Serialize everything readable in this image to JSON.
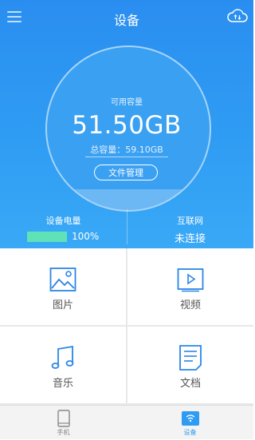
{
  "header": {
    "title": "设备",
    "menu_icon": "menu-icon",
    "cloud_icon": "cloud-sync-icon"
  },
  "storage": {
    "available_label": "可用容量",
    "available_value": "51.50GB",
    "total_text": "总容量：59.10GB",
    "file_button_label": "文件管理"
  },
  "status": {
    "battery_label": "设备电量",
    "battery_value": "100%",
    "battery_level": 1.0,
    "battery_color": "#5fe3b6",
    "network_label": "互联网",
    "network_value": "未连接"
  },
  "categories": [
    {
      "label": "图片",
      "icon": "image-icon"
    },
    {
      "label": "视频",
      "icon": "video-icon"
    },
    {
      "label": "音乐",
      "icon": "music-icon"
    },
    {
      "label": "文档",
      "icon": "document-icon"
    }
  ],
  "tabs": [
    {
      "label": "手机",
      "icon": "phone-icon",
      "active": false
    },
    {
      "label": "设备",
      "icon": "device-wifi-icon",
      "active": true
    }
  ],
  "colors": {
    "primary": "#2f9cf3",
    "icon_blue": "#2a86e8",
    "tab_inactive": "#888888"
  }
}
